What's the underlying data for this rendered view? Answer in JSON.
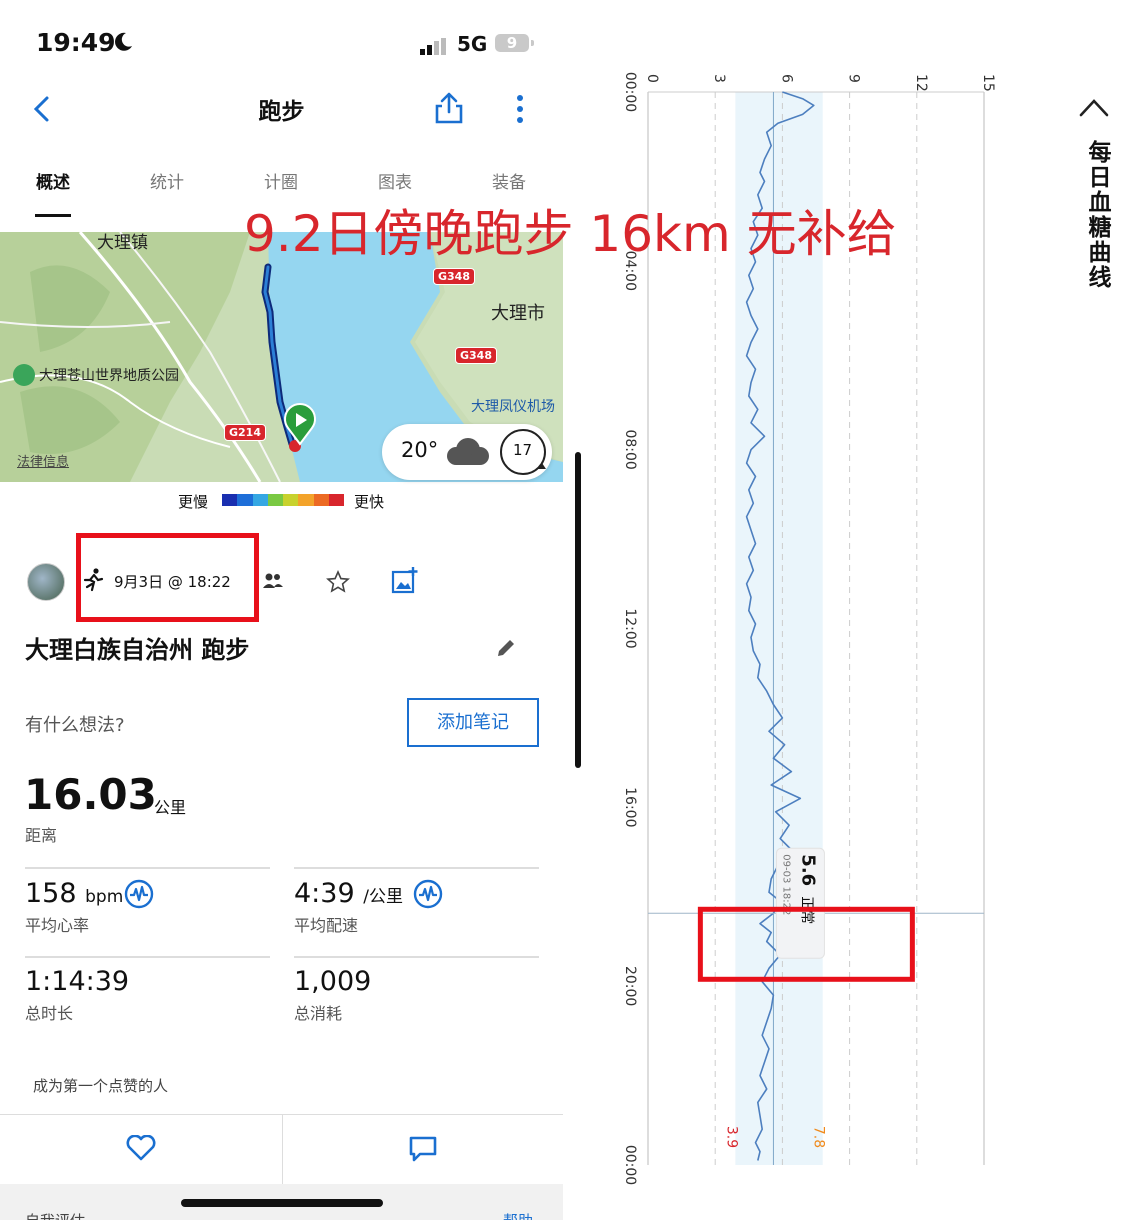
{
  "status_bar": {
    "time": "19:49",
    "network": "5G",
    "battery": "9"
  },
  "nav": {
    "title": "跑步"
  },
  "tabs": [
    "概述",
    "统计",
    "计圈",
    "图表",
    "装备"
  ],
  "map": {
    "labels": {
      "town": "大理镇",
      "city": "大理市",
      "park": "大理苍山世界地质公园",
      "airport": "大理凤仪机场",
      "legal": "法律信息"
    },
    "road_badges": [
      "G348",
      "G348",
      "G214"
    ],
    "weather": {
      "temperature": "20°",
      "wind": "17"
    }
  },
  "pace_legend": {
    "slow": "更慢",
    "fast": "更快",
    "colors": [
      "#1a2fb0",
      "#1e6ed8",
      "#35a7e3",
      "#7ac943",
      "#c8d22e",
      "#f3a32a",
      "#ec6a23",
      "#d8262c"
    ]
  },
  "activity": {
    "datetime": "9月3日 @ 18:22",
    "title": "大理白族自治州 跑步",
    "thought_prompt": "有什么想法?",
    "add_note": "添加笔记",
    "distance": {
      "value": "16.03",
      "unit": "公里",
      "label": "距离"
    },
    "heart_rate": {
      "value": "158",
      "unit": "bpm",
      "label": "平均心率"
    },
    "pace": {
      "value": "4:39",
      "unit": "/公里",
      "label": "平均配速"
    },
    "duration": {
      "value": "1:14:39",
      "label": "总时长"
    },
    "calories": {
      "value": "1,009",
      "label": "总消耗"
    },
    "like_prompt": "成为第一个点赞的人",
    "footer_left": "自我评估",
    "footer_right": "帮助"
  },
  "overlay_text": "9.2日傍晚跑步 16km 无补给",
  "glucose_chart": {
    "title": "每日血糖曲线",
    "tooltip": {
      "value": "5.6",
      "status": "正常",
      "time": "09-03 18:22"
    }
  },
  "chart_data": {
    "type": "line",
    "title": "每日血糖曲线",
    "xlabel": "",
    "ylabel": "",
    "x_ticks": [
      "00:00",
      "04:00",
      "08:00",
      "12:00",
      "16:00",
      "20:00",
      "00:00"
    ],
    "y_ticks": [
      0,
      3,
      6,
      9,
      12,
      15
    ],
    "ylim": [
      0,
      15
    ],
    "xlim_hours": [
      0,
      24
    ],
    "target_range": [
      3.9,
      7.8
    ],
    "threshold_labels": [
      "3.9",
      "7.8"
    ],
    "reference_value": 5.6,
    "cursor_time_hours": 18.37,
    "colors": {
      "line": "#4d7fbf",
      "band": "#eaf5fb",
      "low": "#d8262c",
      "high": "#f08a1c"
    },
    "series": [
      {
        "x": [
          0.0,
          0.15,
          0.3,
          0.5,
          0.7,
          0.9,
          1.2,
          1.5,
          1.8,
          2.0,
          2.3,
          2.6,
          2.9,
          3.2,
          3.5,
          3.8,
          4.1,
          4.4,
          4.7,
          5.0,
          5.3,
          5.6,
          5.9,
          6.2,
          6.5,
          6.8,
          7.1,
          7.4,
          7.7,
          8.0,
          8.3,
          8.6,
          8.9,
          9.2,
          9.5,
          9.8,
          10.1,
          10.4,
          10.7,
          11.0,
          11.3,
          11.6,
          11.9,
          12.2,
          12.5,
          12.8,
          13.1,
          13.4,
          13.7,
          14.0,
          14.3,
          14.6,
          14.9,
          15.2,
          15.5,
          15.8,
          16.1,
          16.4,
          16.7,
          17.0,
          17.3,
          17.6,
          17.9,
          18.1,
          18.37,
          18.6,
          18.8,
          19.0,
          19.3,
          19.6,
          19.9,
          20.2,
          20.5,
          20.8,
          21.1,
          21.4,
          21.7,
          22.0,
          22.3,
          22.6,
          22.9,
          23.2,
          23.5,
          23.7,
          23.9
        ],
        "y": [
          6.0,
          6.9,
          7.4,
          6.9,
          5.8,
          5.3,
          5.5,
          5.2,
          5.0,
          5.2,
          4.9,
          5.1,
          4.7,
          4.9,
          4.6,
          4.8,
          4.5,
          4.7,
          4.4,
          4.6,
          4.9,
          4.6,
          4.4,
          4.8,
          4.6,
          4.5,
          4.9,
          4.6,
          5.2,
          4.6,
          4.4,
          4.8,
          4.5,
          4.7,
          4.4,
          4.6,
          4.8,
          4.5,
          4.7,
          4.4,
          4.6,
          4.5,
          4.8,
          4.6,
          4.7,
          5.0,
          4.9,
          5.3,
          5.6,
          6.0,
          5.4,
          6.1,
          5.6,
          6.4,
          5.5,
          6.8,
          5.7,
          6.3,
          5.9,
          6.5,
          5.8,
          5.5,
          5.4,
          5.9,
          5.6,
          5.0,
          5.5,
          5.3,
          5.9,
          5.4,
          5.1,
          5.6,
          5.5,
          5.3,
          5.1,
          5.4,
          5.2,
          5.0,
          5.3,
          4.9,
          5.0,
          5.1,
          4.8,
          5.0,
          4.9
        ]
      }
    ]
  }
}
